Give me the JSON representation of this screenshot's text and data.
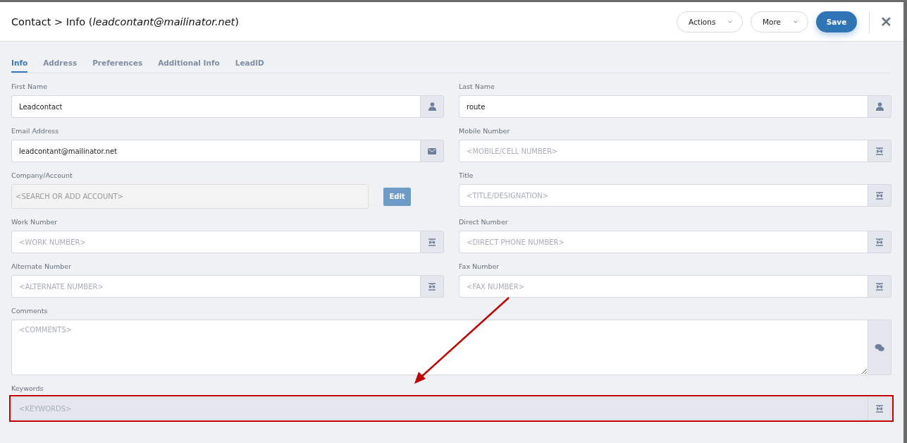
{
  "header": {
    "title": "Contact > Info (*leadcontant@mailinator.net*)",
    "buttons": [
      {
        "label": "Actions",
        "kind": "dropdown"
      },
      {
        "label": "More",
        "kind": "dropdown"
      },
      {
        "label": "Save",
        "kind": "primary"
      }
    ],
    "close": "✕"
  },
  "tabs": [
    {
      "label": "Info",
      "selected": true
    },
    {
      "label": "Address",
      "selected": false
    },
    {
      "label": "Preferences",
      "selected": false
    },
    {
      "label": "Additional Info",
      "selected": false
    },
    {
      "label": "LeadID",
      "selected": false
    }
  ],
  "rows": [
    {
      "fields": [
        {
          "label": "First Name",
          "value": "Leadcontact",
          "kind": "name"
        },
        {
          "label": "Last Name",
          "value": "route",
          "kind": "name"
        }
      ]
    },
    {
      "fields": [
        {
          "label": "Email Address",
          "value": "leadcontant@mailinator.net",
          "kind": "email"
        },
        {
          "label": "Mobile Number",
          "placeholder": "<MOBILE/CELL NUMBER>",
          "kind": "text"
        }
      ]
    },
    {
      "fields": [
        {
          "label": "Company/Account",
          "placeholder": "<SEARCH OR ADD ACCOUNT>",
          "kind": "account",
          "button": "Edit"
        },
        {
          "label": "Title",
          "placeholder": "<TITLE/DESIGNATION>",
          "kind": "text"
        }
      ]
    },
    {
      "fields": [
        {
          "label": "Work Number",
          "placeholder": "<WORK NUMBER>",
          "kind": "text"
        },
        {
          "label": "Direct Number",
          "placeholder": "<DIRECT PHONE NUMBER>",
          "kind": "text"
        }
      ]
    },
    {
      "fields": [
        {
          "label": "Alternate Number",
          "placeholder": "<ALTERNATE NUMBER>",
          "kind": "text"
        },
        {
          "label": "Fax Number",
          "placeholder": "<FAX NUMBER>",
          "kind": "text"
        }
      ]
    },
    {
      "fields": [
        {
          "label": "Comments",
          "placeholder": "<COMMENTS>",
          "kind": "comments"
        }
      ]
    },
    {
      "fields": [
        {
          "label": "Keywords",
          "placeholder": "<KEYWORDS>",
          "kind": "text",
          "disabled": true,
          "highlighted": true
        }
      ]
    }
  ]
}
